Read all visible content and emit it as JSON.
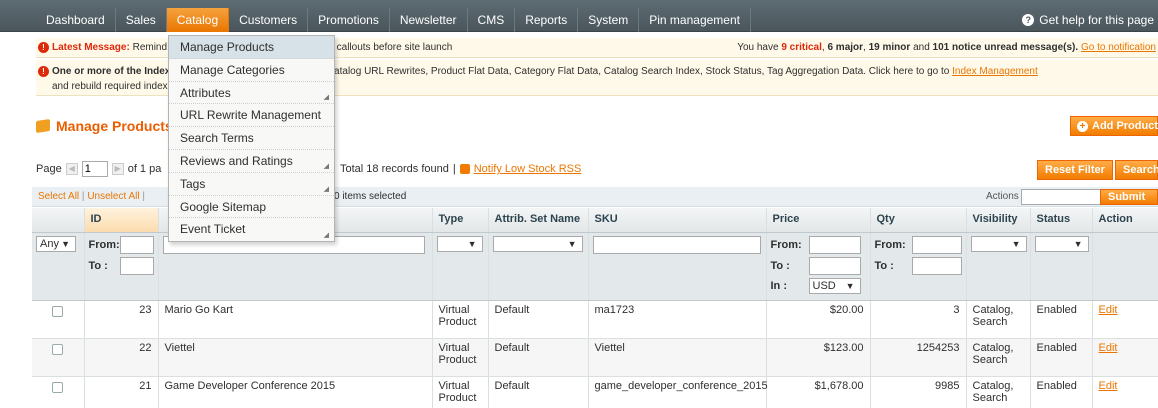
{
  "nav": {
    "items": [
      "Dashboard",
      "Sales",
      "Catalog",
      "Customers",
      "Promotions",
      "Newsletter",
      "CMS",
      "Reports",
      "System",
      "Pin management"
    ],
    "active": "Catalog",
    "help": "Get help for this page"
  },
  "catalog_menu": [
    {
      "label": "Manage Products",
      "sub": false
    },
    {
      "label": "Manage Categories",
      "sub": false
    },
    {
      "label": "Attributes",
      "sub": true
    },
    {
      "label": "URL Rewrite Management",
      "sub": false
    },
    {
      "label": "Search Terms",
      "sub": false
    },
    {
      "label": "Reviews and Ratings",
      "sub": true
    },
    {
      "label": "Tags",
      "sub": true
    },
    {
      "label": "Google Sitemap",
      "sub": false
    },
    {
      "label": "Event Ticket",
      "sub": true
    }
  ],
  "notices": {
    "latest_label": "Latest Message:",
    "latest_text_start": "Remind",
    "latest_text_end": "umbers and callouts before site launch",
    "summary_pre": "You have",
    "critical": "9 critical",
    "major": "6 major",
    "minor": "19 minor",
    "notice": "101 notice unread message(s).",
    "goto_link": "Go to notification",
    "index_label": "One or more of the Index",
    "index_text": "utes, Catalog URL Rewrites, Product Flat Data, Category Flat Data, Catalog Search Index, Stock Status, Tag Aggregation Data. Click here to go to",
    "index_link": "Index Management",
    "index_line2": "and rebuild required index"
  },
  "page": {
    "title": "Manage Products",
    "add_button": "Add Product",
    "reset_button": "Reset Filter",
    "search_button": "Search"
  },
  "pager": {
    "page_label": "Page",
    "page_value": "1",
    "of_pages": "of 1 pa",
    "total": "Total 18 records found",
    "separator": "|",
    "rss_link": "Notify Low Stock RSS"
  },
  "massaction": {
    "select_all": "Select All",
    "unselect_all": "Unselect All",
    "items_selected": "0 items selected",
    "actions_label": "Actions",
    "submit": "Submit"
  },
  "grid": {
    "columns": [
      "",
      "ID",
      "",
      "Type",
      "Attrib. Set Name",
      "SKU",
      "Price",
      "Qty",
      "Visibility",
      "Status",
      "Action"
    ],
    "filter": {
      "any": "Any",
      "from": "From:",
      "to": "To :",
      "in": "In :",
      "currency": "USD"
    },
    "rows": [
      {
        "id": "23",
        "name": "Mario Go Kart",
        "type1": "Virtual",
        "type2": "Product",
        "set": "Default",
        "sku": "ma1723",
        "price": "$20.00",
        "qty": "3",
        "vis1": "Catalog,",
        "vis2": "Search",
        "status": "Enabled",
        "action": "Edit"
      },
      {
        "id": "22",
        "name": "Viettel",
        "type1": "Virtual",
        "type2": "Product",
        "set": "Default",
        "sku": "Viettel",
        "price": "$123.00",
        "qty": "1254253",
        "vis1": "Catalog,",
        "vis2": "Search",
        "status": "Enabled",
        "action": "Edit"
      },
      {
        "id": "21",
        "name": "Game Developer Conference 2015",
        "type1": "Virtual",
        "type2": "Product",
        "set": "Default",
        "sku": "game_developer_conference_2015",
        "price": "$1,678.00",
        "qty": "9985",
        "vis1": "Catalog,",
        "vis2": "Search",
        "status": "Enabled",
        "action": "Edit"
      }
    ]
  },
  "colors": {
    "accent": "#eb5e00",
    "nav": "#4a565c",
    "active_tab": "#ea7601",
    "link": "#ea7601",
    "critical": "#df280a"
  }
}
